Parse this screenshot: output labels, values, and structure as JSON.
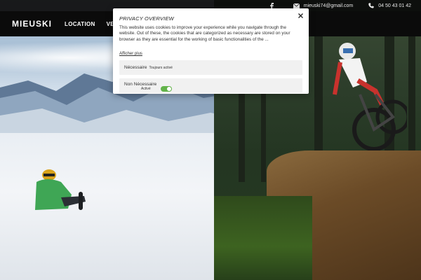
{
  "topbar": {
    "email": "mieuski74@gmail.com",
    "phone": "04 50 43 01 42"
  },
  "nav": {
    "logo": "MIEUSKI",
    "items": [
      "LOCATION",
      "VENTE"
    ]
  },
  "modal": {
    "title": "PRIVACY OVERVIEW",
    "text": "This website uses cookies to improve your experience while you navigate through the website. Out of these, the cookies that are categorized as necessary are stored on your browser as they are essential for the working of basic functionalities of the ...",
    "show_more": "Afficher plus",
    "categories": [
      {
        "name": "Nécessaire",
        "status": "Toujours activé"
      },
      {
        "name": "Non Nécessaire",
        "toggle_label": "Activé"
      }
    ]
  },
  "colors": {
    "toggle_on": "#62b34a",
    "navbar_bg": "#0b0b0b"
  }
}
